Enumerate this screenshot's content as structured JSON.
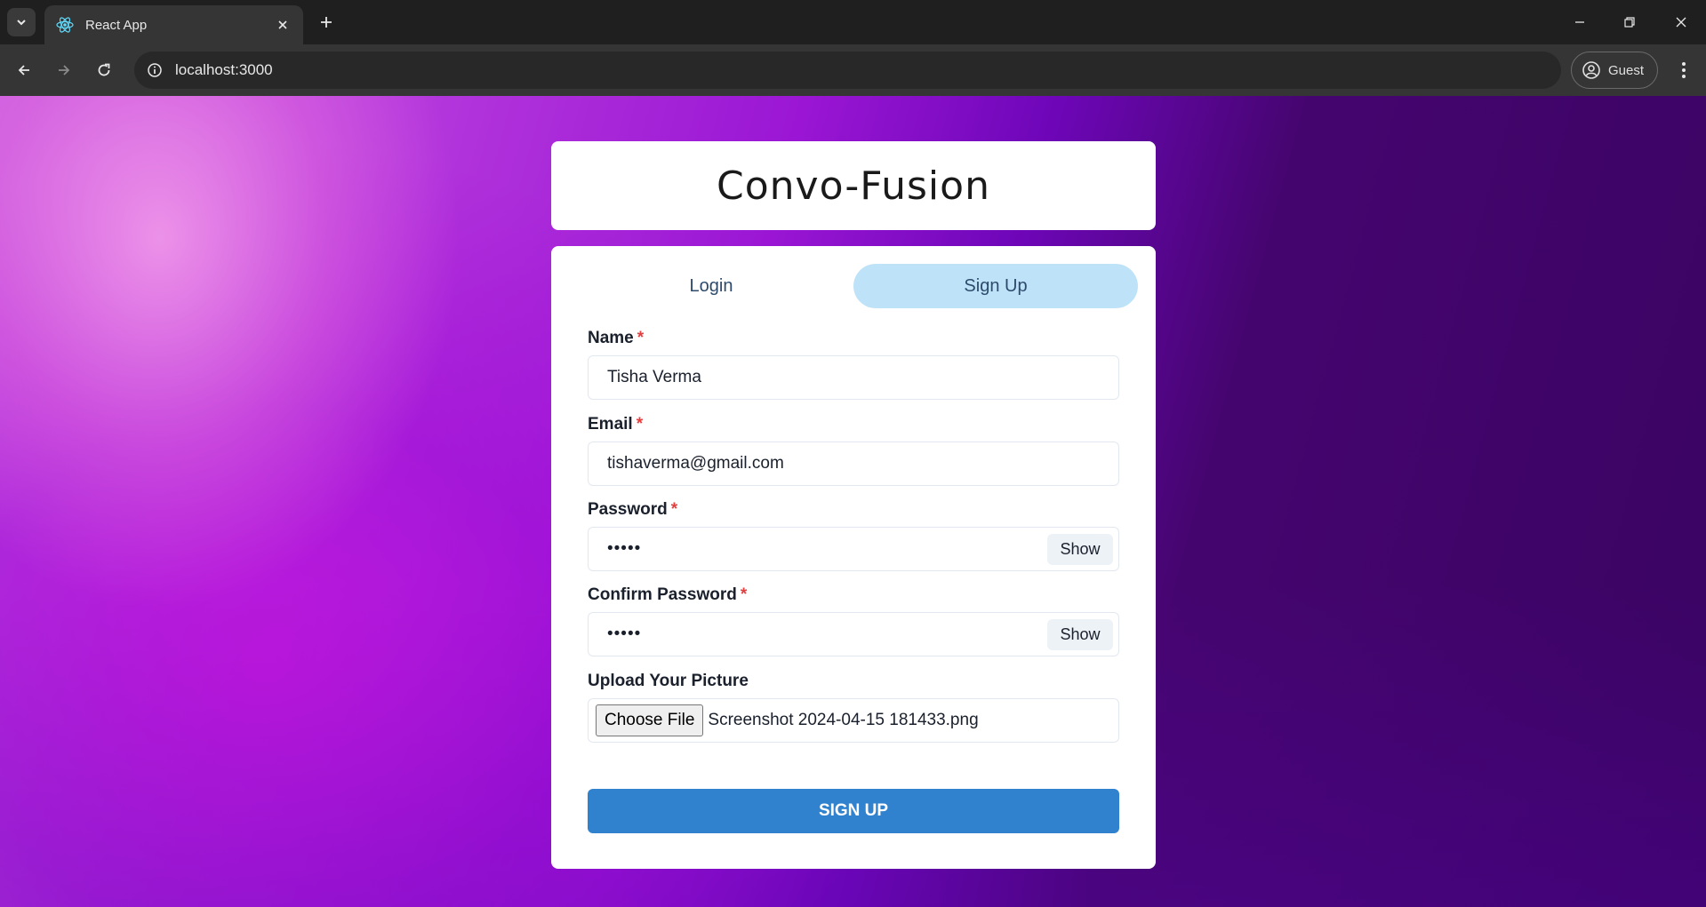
{
  "browser": {
    "tab": {
      "title": "React App",
      "favicon": "react-atom-icon"
    },
    "omnibox": {
      "url": "localhost:3000"
    },
    "profile": {
      "label": "Guest"
    },
    "colors": {
      "chrome_dark": "#1f1f1f",
      "toolbar": "#353535",
      "omnibox": "#282828"
    }
  },
  "app": {
    "title": "Convo-Fusion",
    "tabs": [
      {
        "label": "Login",
        "selected": false
      },
      {
        "label": "Sign Up",
        "selected": true
      }
    ],
    "form": {
      "name": {
        "label": "Name",
        "required_mark": "*",
        "value": "Tisha Verma"
      },
      "email": {
        "label": "Email",
        "required_mark": "*",
        "value": "tishaverma@gmail.com"
      },
      "password": {
        "label": "Password",
        "required_mark": "*",
        "value_masked": "•••••",
        "toggle_label": "Show"
      },
      "confirm_password": {
        "label": "Confirm Password",
        "required_mark": "*",
        "value_masked": "•••••",
        "toggle_label": "Show"
      },
      "picture": {
        "label": "Upload Your Picture",
        "button_label": "Choose File",
        "file_name": "Screenshot 2024-04-15 181433.png"
      },
      "submit_label": "SIGN UP"
    },
    "colors": {
      "accent": "#3182ce",
      "tab_selected_bg": "#bee3f8",
      "required": "#e53e3e",
      "background_purple": "#9a16d4"
    }
  }
}
